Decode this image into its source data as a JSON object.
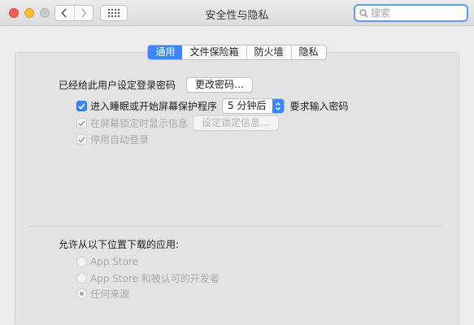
{
  "window": {
    "title": "安全性与隐私",
    "search": {
      "placeholder": "搜索",
      "value": ""
    }
  },
  "tabs": [
    {
      "label": "通用",
      "active": true
    },
    {
      "label": "文件保险箱",
      "active": false
    },
    {
      "label": "防火墙",
      "active": false
    },
    {
      "label": "隐私",
      "active": false
    }
  ],
  "general": {
    "password_label": "已经给此用户设定登录密码",
    "change_password_button": "更改密码…",
    "require_password": {
      "prefix": "进入睡眠或开始屏幕保护程序",
      "delay_value": "5 分钟后",
      "suffix": "要求输入密码",
      "checked": true
    },
    "show_message": {
      "label": "在屏幕锁定时显示信息",
      "checked": true,
      "enabled": false
    },
    "set_lock_message_button": "设定锁定信息…",
    "disable_auto_login": {
      "label": "停用自动登录",
      "checked": true,
      "enabled": false
    }
  },
  "downloads": {
    "heading": "允许从以下位置下载的应用:",
    "options": [
      {
        "label": "App Store",
        "selected": false
      },
      {
        "label": "App Store 和被认可的开发者",
        "selected": false
      },
      {
        "label": "任何来源",
        "selected": true
      }
    ]
  },
  "colors": {
    "accent": "#3d86f7",
    "window_bg": "#ececec",
    "panel_bg": "#e3e3e3"
  }
}
